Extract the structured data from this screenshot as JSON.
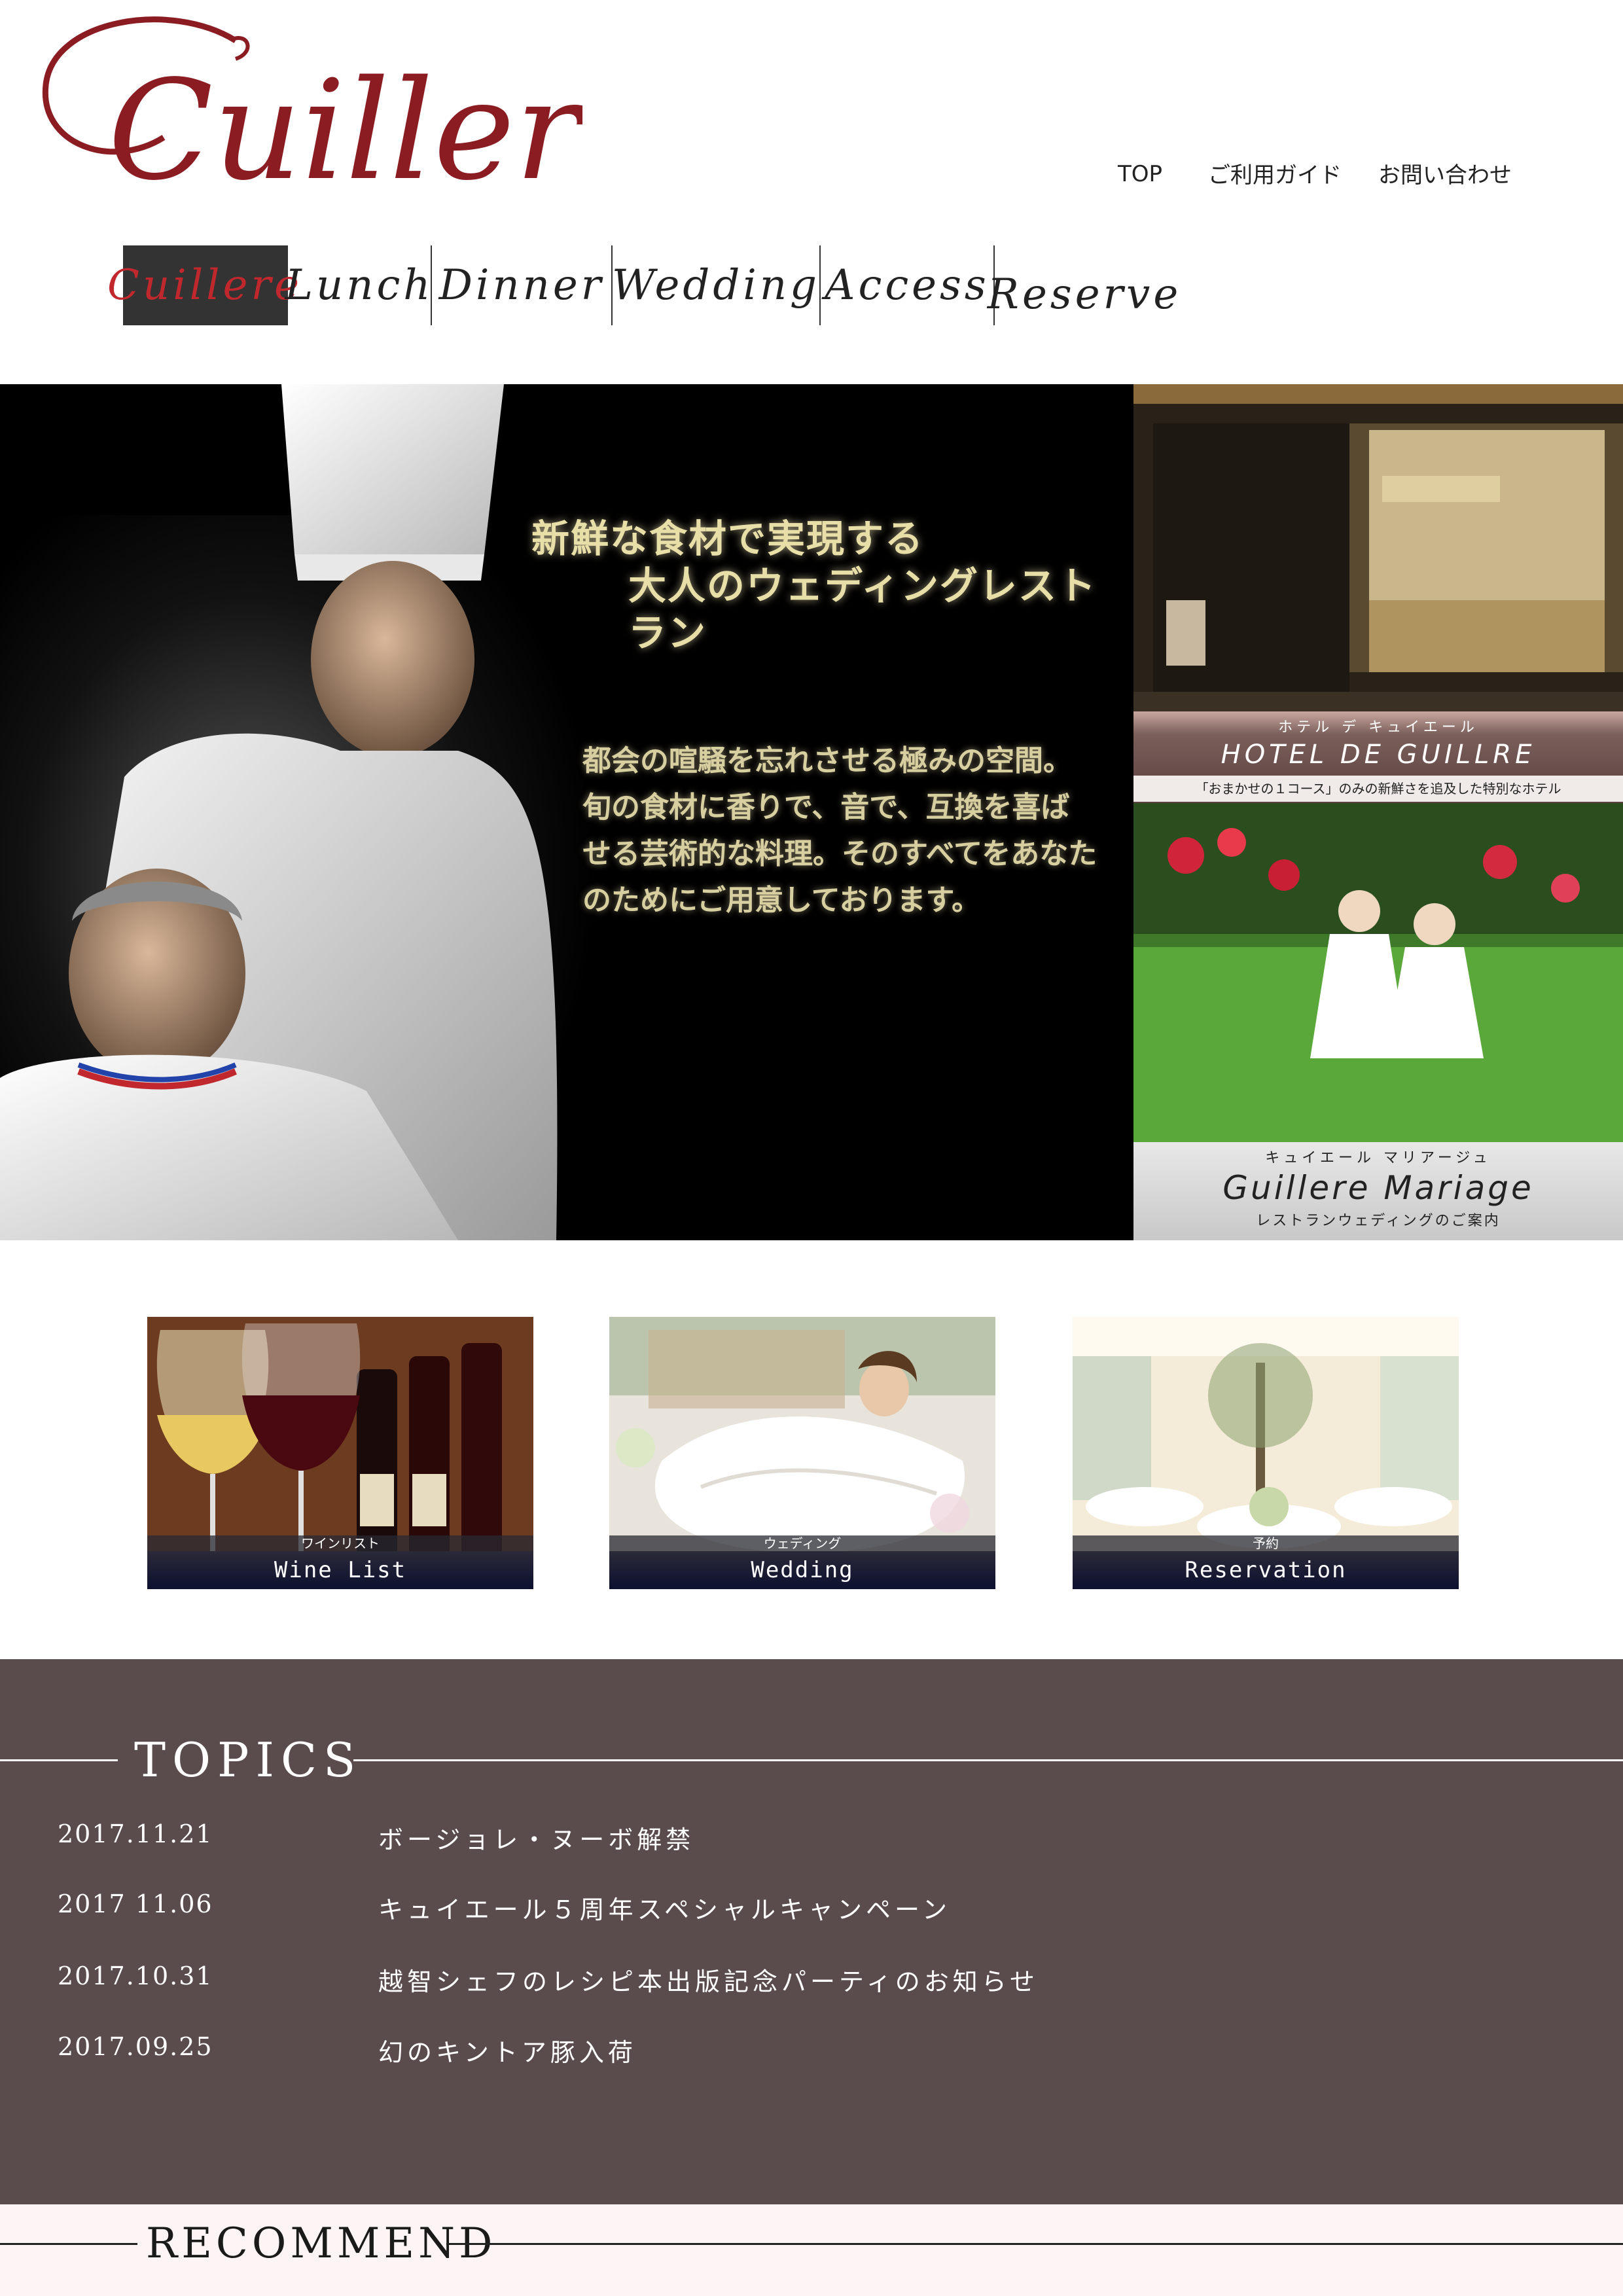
{
  "brand": {
    "logo_text": "Cuillere",
    "logo_color": "#8b1c22"
  },
  "util_nav": {
    "top": "TOP",
    "guide": "ご利用ガイド",
    "contact": "お問い合わせ"
  },
  "global_nav": {
    "items": [
      {
        "label": "Cuillere",
        "active": true
      },
      {
        "label": "Lunch"
      },
      {
        "label": "Dinner"
      },
      {
        "label": "Wedding"
      },
      {
        "label": "Access"
      },
      {
        "label": "Reserve"
      }
    ],
    "active_bg": "#333333",
    "active_color": "#c0282e"
  },
  "hero": {
    "title_line1": "新鮮な食材で実現する",
    "title_line2": "大人のウェディングレストラン",
    "body_line1": "都会の喧騒を忘れさせる極みの空間。",
    "body_line2": "旬の食材に香りで、音で、互換を喜ば",
    "body_line3": "せる芸術的な料理。そのすべてをあなた",
    "body_line4": "のためにご用意しております。"
  },
  "side_banners": {
    "hotel": {
      "kana": "ホテル デ キュイエール",
      "name": "HOTEL DE GUILLRE",
      "sub": "「おまかせの１コース」のみの新鮮さを追及した特別なホテル"
    },
    "mariage": {
      "kana": "キュイエール マリアージュ",
      "name": "Guillere Mariage",
      "sub": "レストランウェディングのご案内"
    }
  },
  "cards": [
    {
      "kana": "ワインリスト",
      "name": "Wine List"
    },
    {
      "kana": "ウェディング",
      "name": "Wedding"
    },
    {
      "kana": "予約",
      "name": "Reservation"
    }
  ],
  "topics": {
    "heading": "TOPICS",
    "items": [
      {
        "date": "2017.11.21",
        "text": "ボージョレ・ヌーボ解禁"
      },
      {
        "date": "2017 11.06",
        "text": "キュイエール５周年スペシャルキャンペーン"
      },
      {
        "date": "2017.10.31",
        "text": "越智シェフのレシピ本出版記念パーティのお知らせ"
      },
      {
        "date": "2017.09.25",
        "text": "幻のキントア豚入荷"
      }
    ],
    "bg_color": "#5a4c4c"
  },
  "recommend": {
    "heading": "RECOMMEND"
  }
}
